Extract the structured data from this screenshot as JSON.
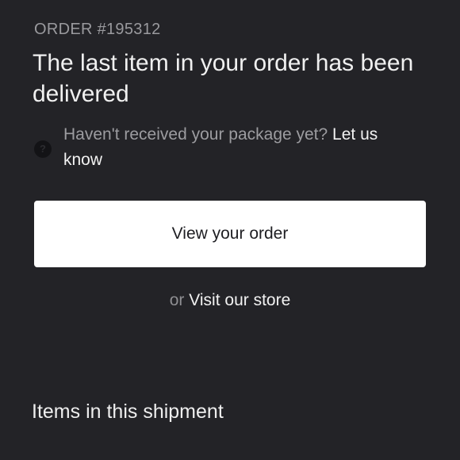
{
  "order": {
    "number_label": "ORDER #195312",
    "headline": "The last item in your order has been delivered"
  },
  "help": {
    "icon": "question-icon",
    "icon_glyph": "?",
    "prompt": "Haven't received your package yet?",
    "link_label": "Let us know"
  },
  "actions": {
    "view_order_label": "View your order",
    "or_label": "or",
    "visit_store_label": "Visit our store"
  },
  "shipment": {
    "section_title": "Items in this shipment"
  },
  "colors": {
    "background": "#232327",
    "primary_button": "#ffffff",
    "muted_text": "#9c9ca0",
    "bright_text": "#f2f2f2"
  }
}
